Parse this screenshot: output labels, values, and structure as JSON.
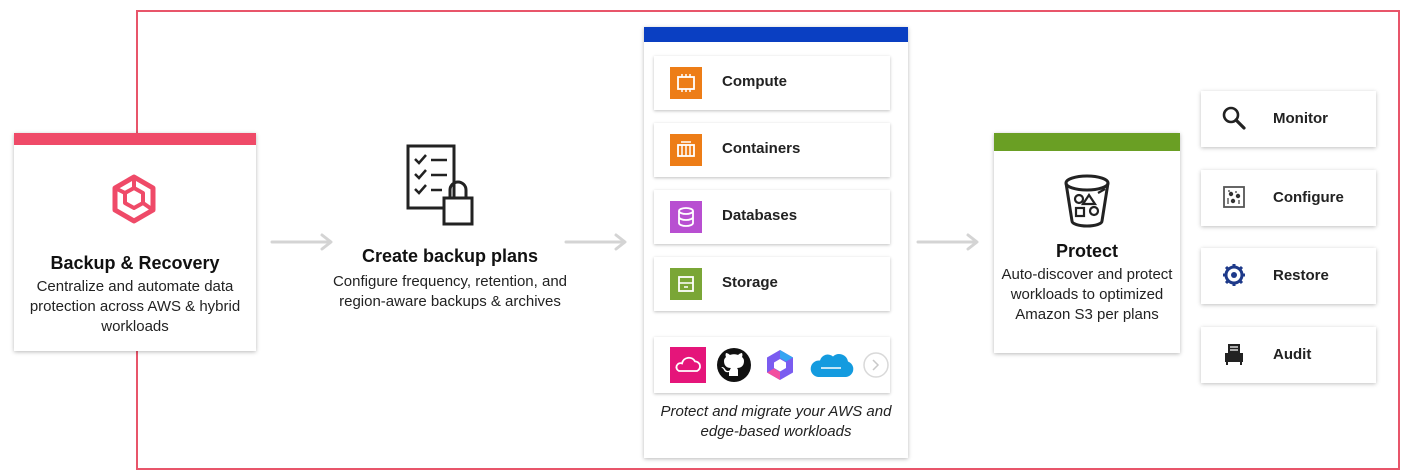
{
  "colors": {
    "frame": "#e8556a",
    "backup_accent": "#ef4a68",
    "workloads_accent": "#0a3fc2",
    "protect_accent": "#6a9f24",
    "compute_tile": "#ed7d17",
    "database_tile": "#b84fd1",
    "storage_tile": "#7aa636"
  },
  "backup": {
    "icon": "aws-backup-cube-icon",
    "title": "Backup & Recovery",
    "description": "Centralize and automate data protection across AWS & hybrid workloads"
  },
  "plans": {
    "icon": "checklist-lock-icon",
    "title": "Create backup plans",
    "description": "Configure frequency, retention, and region-aware backups & archives"
  },
  "workloads": {
    "items": [
      {
        "label": "Compute",
        "icon": "compute-icon"
      },
      {
        "label": "Containers",
        "icon": "containers-icon"
      },
      {
        "label": "Databases",
        "icon": "database-icon"
      },
      {
        "label": "Storage",
        "icon": "storage-icon"
      }
    ],
    "logos": [
      "cloud-app-icon",
      "github-icon",
      "copilot-icon",
      "salesforce-icon",
      "more-icon"
    ],
    "caption": "Protect and migrate your AWS and edge-based workloads"
  },
  "protect": {
    "icon": "s3-bucket-icon",
    "title": "Protect",
    "description": "Auto-discover and protect workloads to optimized Amazon S3 per plans"
  },
  "actions": [
    {
      "label": "Monitor",
      "icon": "magnifier-icon"
    },
    {
      "label": "Configure",
      "icon": "configure-icon"
    },
    {
      "label": "Restore",
      "icon": "restore-gear-icon"
    },
    {
      "label": "Audit",
      "icon": "audit-icon"
    }
  ]
}
